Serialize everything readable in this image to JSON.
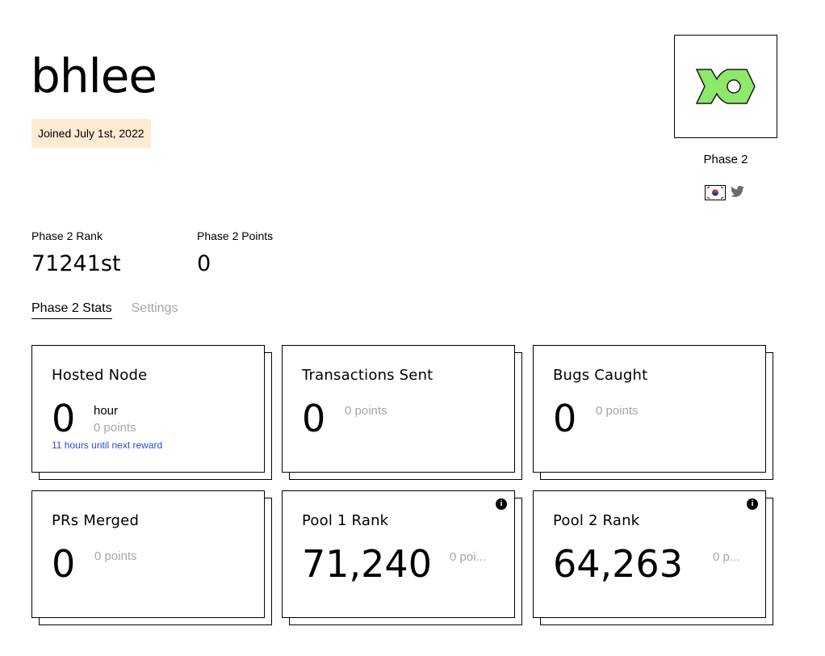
{
  "profile": {
    "username": "bhlee",
    "joined": "Joined July 1st, 2022",
    "phase": "Phase 2",
    "avatar_color": "#8ee86a"
  },
  "stats": {
    "rank_label": "Phase 2 Rank",
    "rank_value": "71241st",
    "points_label": "Phase 2 Points",
    "points_value": "0"
  },
  "tabs": [
    {
      "label": "Phase 2 Stats",
      "active": true
    },
    {
      "label": "Settings",
      "active": false
    }
  ],
  "cards": {
    "hosted_node": {
      "title": "Hosted Node",
      "value": "0",
      "unit": "hour",
      "points": "0 points",
      "reward": "11 hours until next reward"
    },
    "transactions": {
      "title": "Transactions Sent",
      "value": "0",
      "points": "0 points"
    },
    "bugs": {
      "title": "Bugs Caught",
      "value": "0",
      "points": "0 points"
    },
    "prs": {
      "title": "PRs Merged",
      "value": "0",
      "points": "0 points"
    },
    "pool1": {
      "title": "Pool 1 Rank",
      "value": "71,240",
      "points": "0 poi...",
      "info_icon": "info-icon"
    },
    "pool2": {
      "title": "Pool 2 Rank",
      "value": "64,263",
      "points": "0 p...",
      "info_icon": "info-icon"
    }
  },
  "socials": {
    "flag": "south-korea-flag-icon",
    "twitter": "twitter-icon"
  }
}
